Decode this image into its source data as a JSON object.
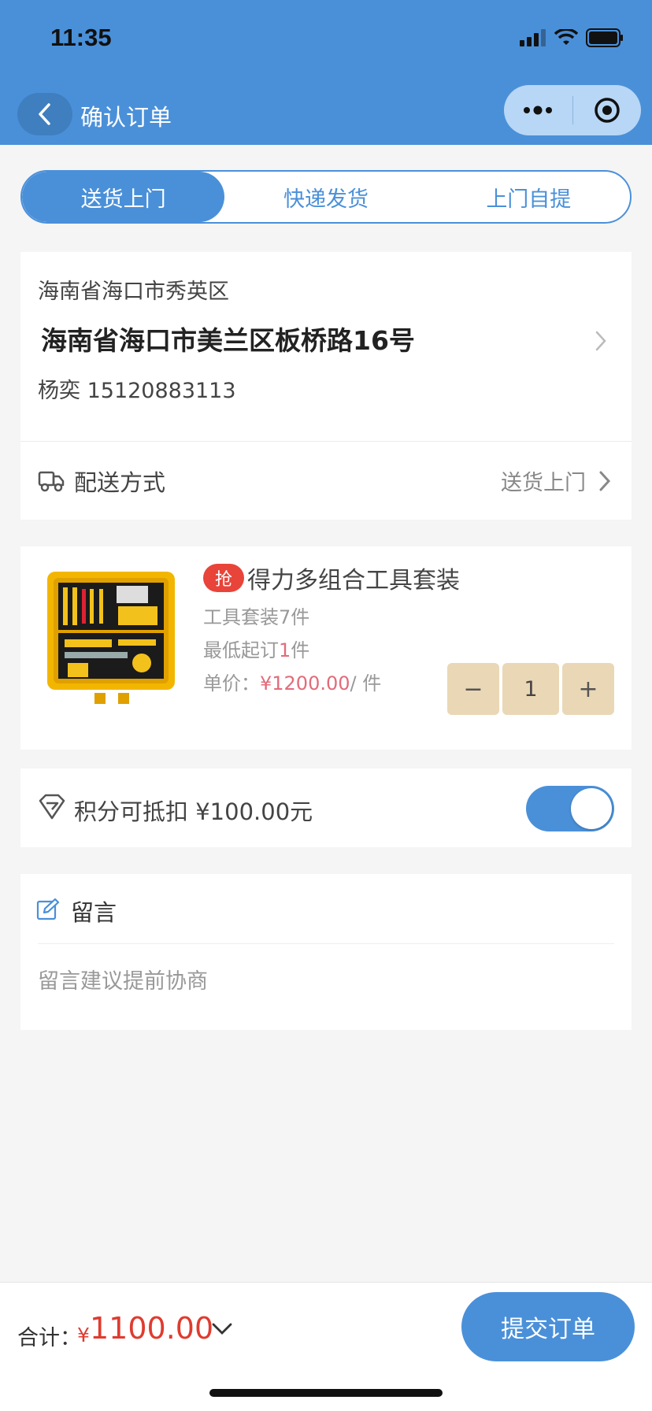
{
  "status_bar": {
    "time": "11:35"
  },
  "nav": {
    "title": "确认订单"
  },
  "delivery_tabs": [
    "送货上门",
    "快递发货",
    "上门自提"
  ],
  "address": {
    "region": "海南省海口市秀英区",
    "detail": "海南省海口市美兰区板桥路16号",
    "contact": "杨奕 15120883113"
  },
  "delivery": {
    "label": "配送方式",
    "value": "送货上门"
  },
  "product": {
    "badge": "抢",
    "name": "得力多组合工具套装",
    "spec": "工具套装7件",
    "min_order_prefix": "最低起订",
    "min_order_qty": "1",
    "min_order_suffix": "件",
    "price_label": "单价：",
    "price": "¥1200.00",
    "price_unit": "/ 件",
    "quantity": "1",
    "minus": "−",
    "plus": "+"
  },
  "points": {
    "label": "积分可抵扣 ¥100.00元",
    "enabled": true
  },
  "message": {
    "title": "留言",
    "placeholder": "留言建议提前协商"
  },
  "footer": {
    "total_label": "合计：",
    "currency": "¥",
    "total_amount": "1100.00",
    "submit_label": "提交订单"
  },
  "colors": {
    "primary": "#4a90d9",
    "price": "#e03b2f",
    "badge": "#e8443a",
    "stepper": "#ead7b6"
  },
  "icons": [
    "back-icon",
    "more-icon",
    "target-icon",
    "truck-icon",
    "chevron-right-icon",
    "diamond-icon",
    "edit-icon",
    "chevron-down-icon"
  ]
}
